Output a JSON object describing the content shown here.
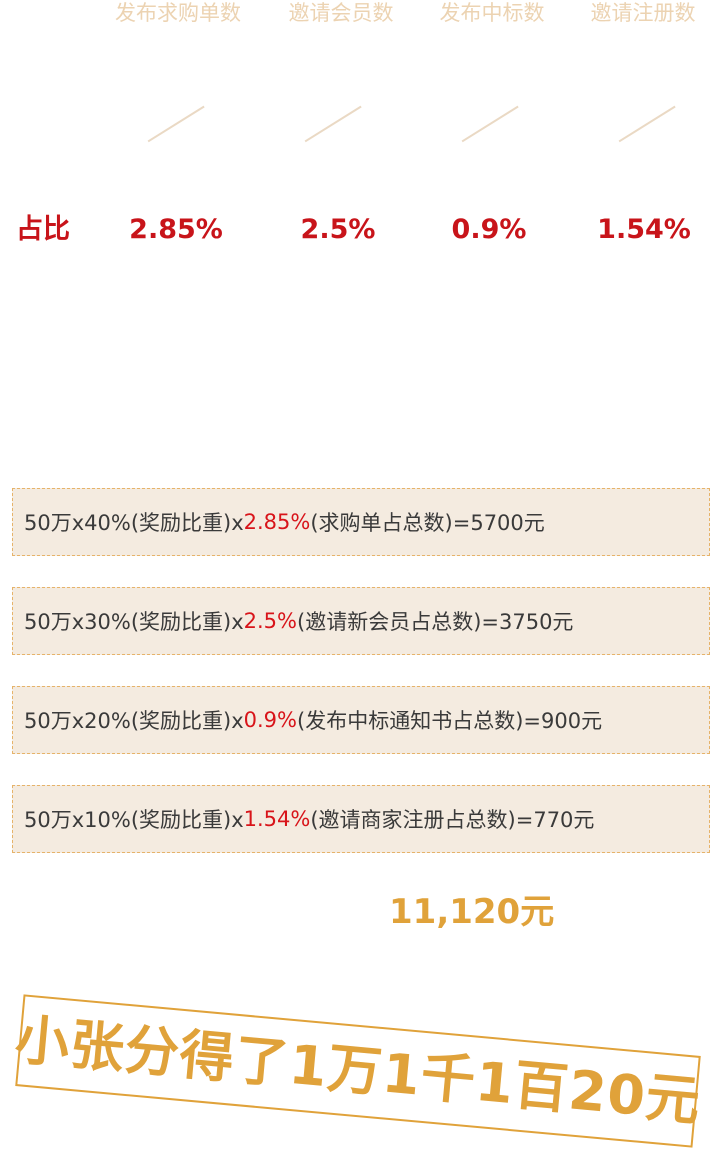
{
  "headers": [
    "发布求购单数",
    "邀请会员数",
    "发布中标数",
    "邀请注册数"
  ],
  "ratio": {
    "label": "占比",
    "values": [
      "2.85%",
      "2.5%",
      "0.9%",
      "1.54%"
    ]
  },
  "formulas": [
    {
      "prefix": "50万x40%(奖励比重)x",
      "highlight": "2.85%",
      "suffix": "(求购单占总数)=5700元"
    },
    {
      "prefix": "50万x30%(奖励比重)x",
      "highlight": "2.5%",
      "suffix": "(邀请新会员占总数)=3750元"
    },
    {
      "prefix": "50万x20%(奖励比重)x",
      "highlight": "0.9%",
      "suffix": "(发布中标通知书占总数)=900元"
    },
    {
      "prefix": "50万x10%(奖励比重)x",
      "highlight": "1.54%",
      "suffix": "(邀请商家注册占总数)=770元"
    }
  ],
  "total": "11,120元",
  "stamp": "小张分得了1万1千1百20元",
  "colors": {
    "header_text": "#ecd3b2",
    "ratio_red": "#c8141a",
    "highlight_red": "#d8141a",
    "gold": "#e0a23a",
    "box_bg": "#f4ebe0"
  }
}
